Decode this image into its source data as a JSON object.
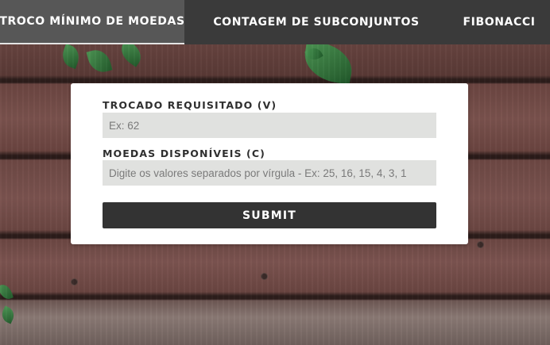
{
  "navbar": {
    "items": [
      {
        "label": "TROCO MÍNIMO DE MOEDAS",
        "active": true
      },
      {
        "label": "CONTAGEM DE SUBCONJUNTOS",
        "active": false
      },
      {
        "label": "FIBONACCI",
        "active": false
      }
    ]
  },
  "form": {
    "change_required": {
      "label": "TROCADO REQUISITADO (V)",
      "placeholder": "Ex: 62",
      "value": ""
    },
    "available_coins": {
      "label": "MOEDAS DISPONÍVEIS (C)",
      "placeholder": "Digite os valores separados por vírgula - Ex: 25, 16, 15, 4, 3, 1",
      "value": ""
    },
    "submit_label": "SUBMIT"
  },
  "colors": {
    "navbar_bg": "#3a3a3a",
    "navbar_active_bg": "#575757",
    "input_bg": "#e0e1df",
    "button_bg": "#333333",
    "card_bg": "#ffffff"
  }
}
